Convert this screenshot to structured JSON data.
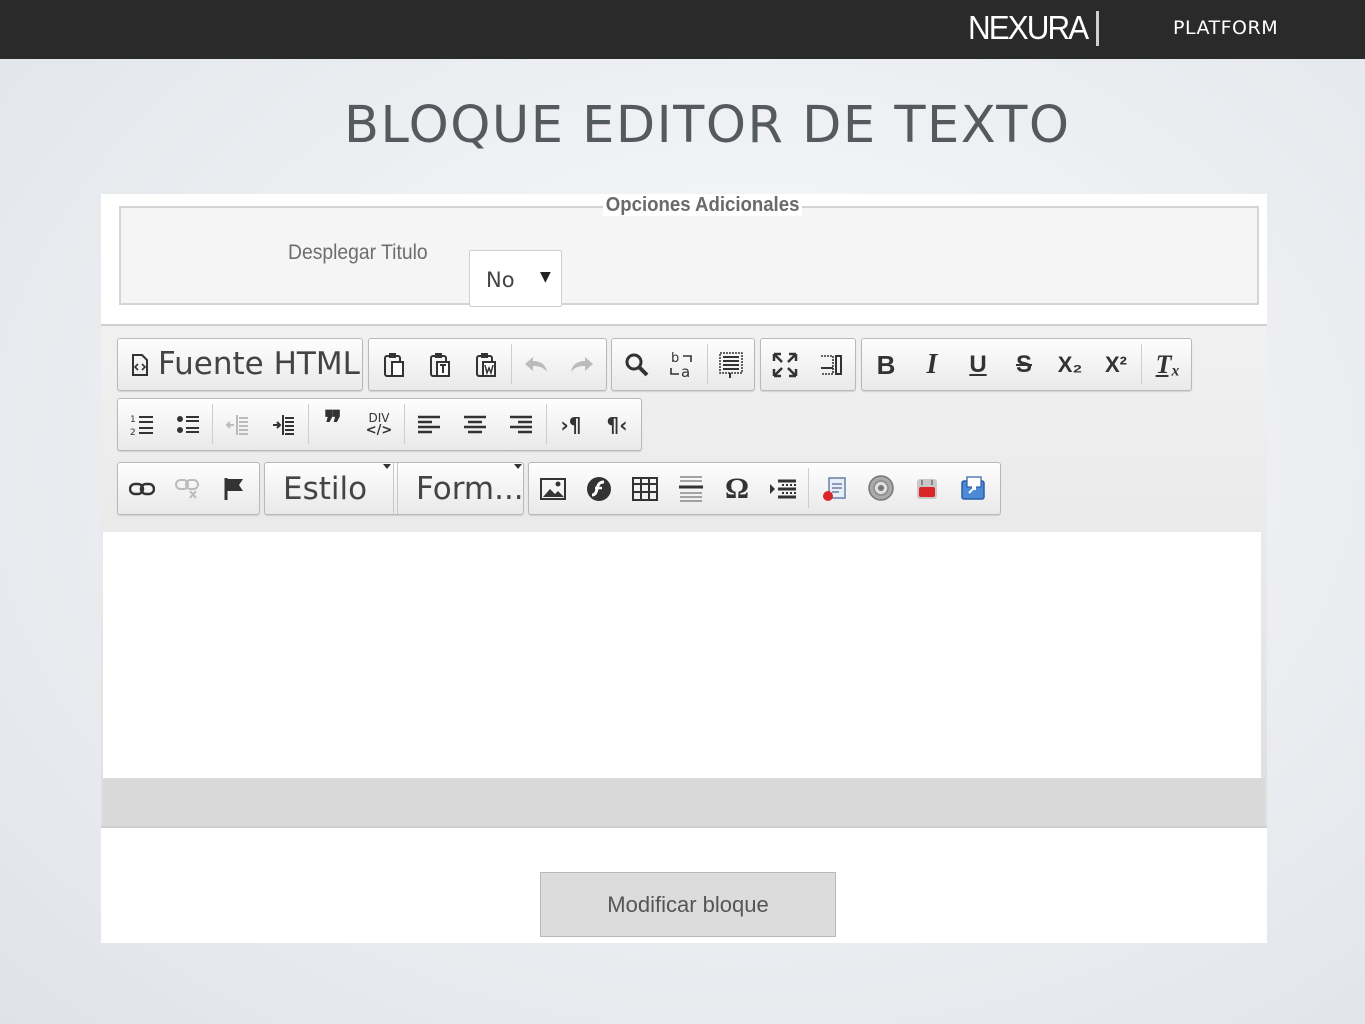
{
  "header": {
    "logo_text": "NEXURA",
    "platform_label": "PLATFORM"
  },
  "page": {
    "title": "BLOQUE EDITOR DE TEXTO"
  },
  "options": {
    "legend": "Opciones Adicionales",
    "display_title_label": "Desplegar Titulo",
    "display_title_value": "No"
  },
  "toolbar": {
    "source_label": "Fuente HTML",
    "style_combo": "Estilo",
    "format_combo": "Form...",
    "div_label": "DIV",
    "icons": {
      "paste": "paste-icon",
      "paste_text": "paste-text-icon",
      "paste_word": "paste-word-icon",
      "undo": "undo-icon",
      "redo": "redo-icon",
      "find": "search-icon",
      "replace": "replace-icon",
      "select_all": "select-all-icon",
      "maximize": "maximize-icon",
      "show_blocks": "show-blocks-icon",
      "bold": "B",
      "italic": "I",
      "underline": "U",
      "strike": "S",
      "subscript": "X₂",
      "superscript": "X²",
      "remove_format": "Tₓ"
    }
  },
  "actions": {
    "submit_label": "Modificar bloque"
  }
}
